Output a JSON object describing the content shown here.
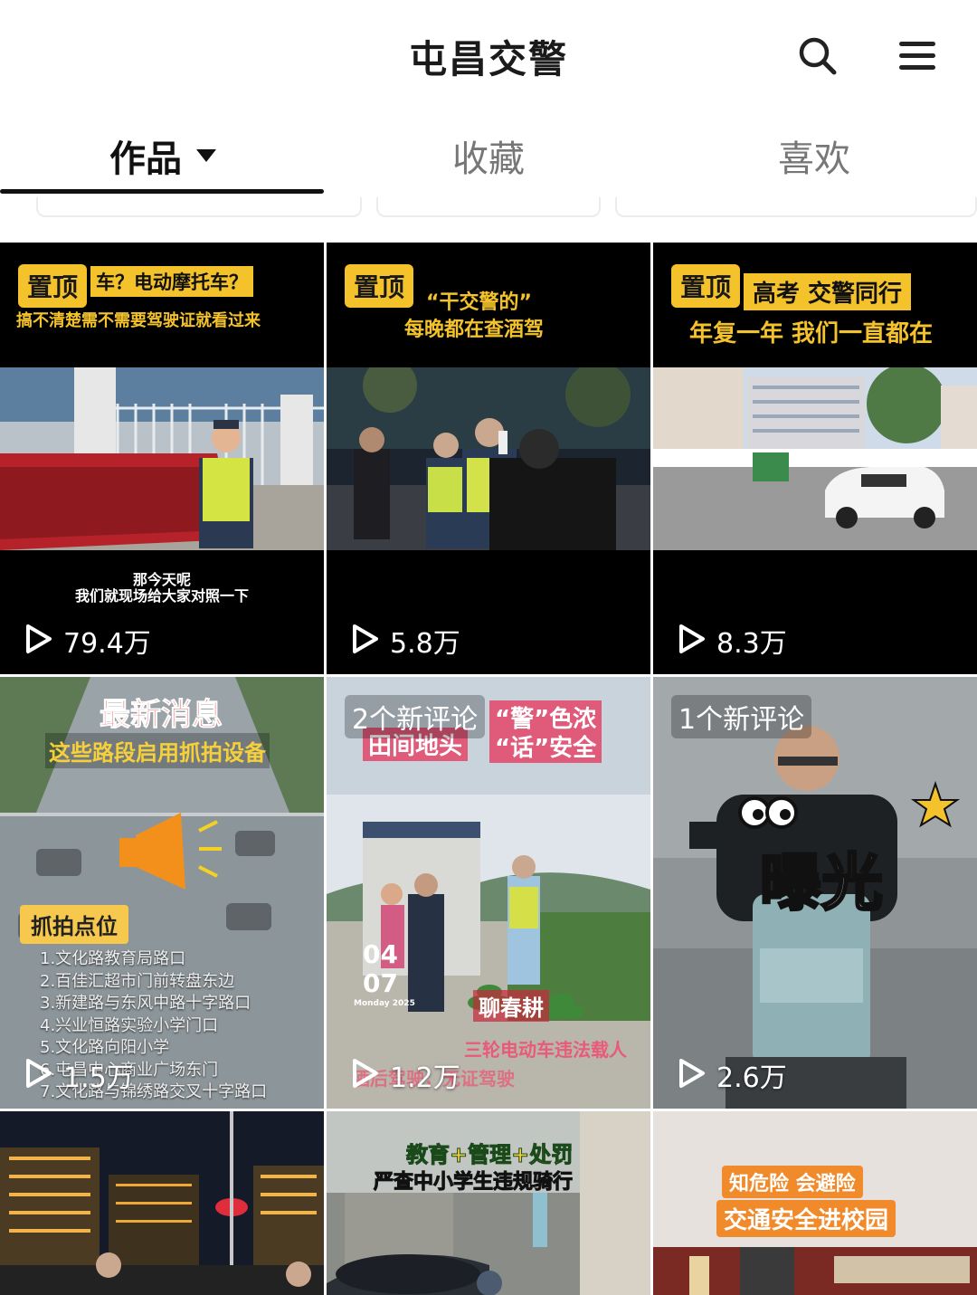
{
  "header": {
    "title": "屯昌交警",
    "search_icon": "search-icon",
    "menu_icon": "menu-icon"
  },
  "tabs": [
    {
      "label": "作品",
      "active": true
    },
    {
      "label": "收藏",
      "active": false
    },
    {
      "label": "喜欢",
      "active": false
    }
  ],
  "videos": [
    {
      "pin": "置顶",
      "title_line1": "车？电动摩托车？",
      "title_line2": "搞不清楚需不需要驾驶证就看过来",
      "caption_line1": "那今天呢",
      "caption_line2": "我们就现场给大家对照一下",
      "views": "79.4万"
    },
    {
      "pin": "置顶",
      "title_line1": "“干交警的”",
      "title_line2": "每晚都在查酒驾",
      "views": "5.8万"
    },
    {
      "pin": "置顶",
      "title_line1": "高考 交警同行",
      "title_line2": "年复一年 我们一直都在",
      "views": "8.3万"
    },
    {
      "title_line1": "最新消息",
      "title_line2": "这些路段启用抓拍设备",
      "badge": "抓拍点位",
      "list": [
        "1.文化路教育局路口",
        "2.百佳汇超市门前转盘东边",
        "3.新建路与东风中路十字路口",
        "4.兴业恒路实验小学门口",
        "5.文化路向阳小学",
        "6.屯昌中心商业广场东门",
        "7.文化路与锦绣路交叉十字路口"
      ],
      "views": "1.5万"
    },
    {
      "comment_badge": "2个新评论",
      "title_left1": "田间地头",
      "title_right1": "“警”色浓",
      "title_right2": "“话”安全",
      "date_line1": "04",
      "date_line2": "07",
      "date_sub": "Monday 2025",
      "sign": "聊春耕",
      "bottom_line1": "三轮电动车违法载人",
      "bottom_line2": "酒后驾驶，无证驾驶",
      "views": "1.2万"
    },
    {
      "comment_badge": "1个新评论",
      "sticker": "曝光",
      "views": "2.6万"
    },
    {},
    {
      "title_line1": "教育+管理+处罚",
      "title_line2": "严查中小学生违规骑行"
    },
    {
      "title_line1": "知危险 会避险",
      "title_line2": "交通安全进校园"
    }
  ],
  "colors": {
    "accent_yellow": "#f4c22b",
    "tab_active": "#111111",
    "tab_inactive": "#777777"
  }
}
